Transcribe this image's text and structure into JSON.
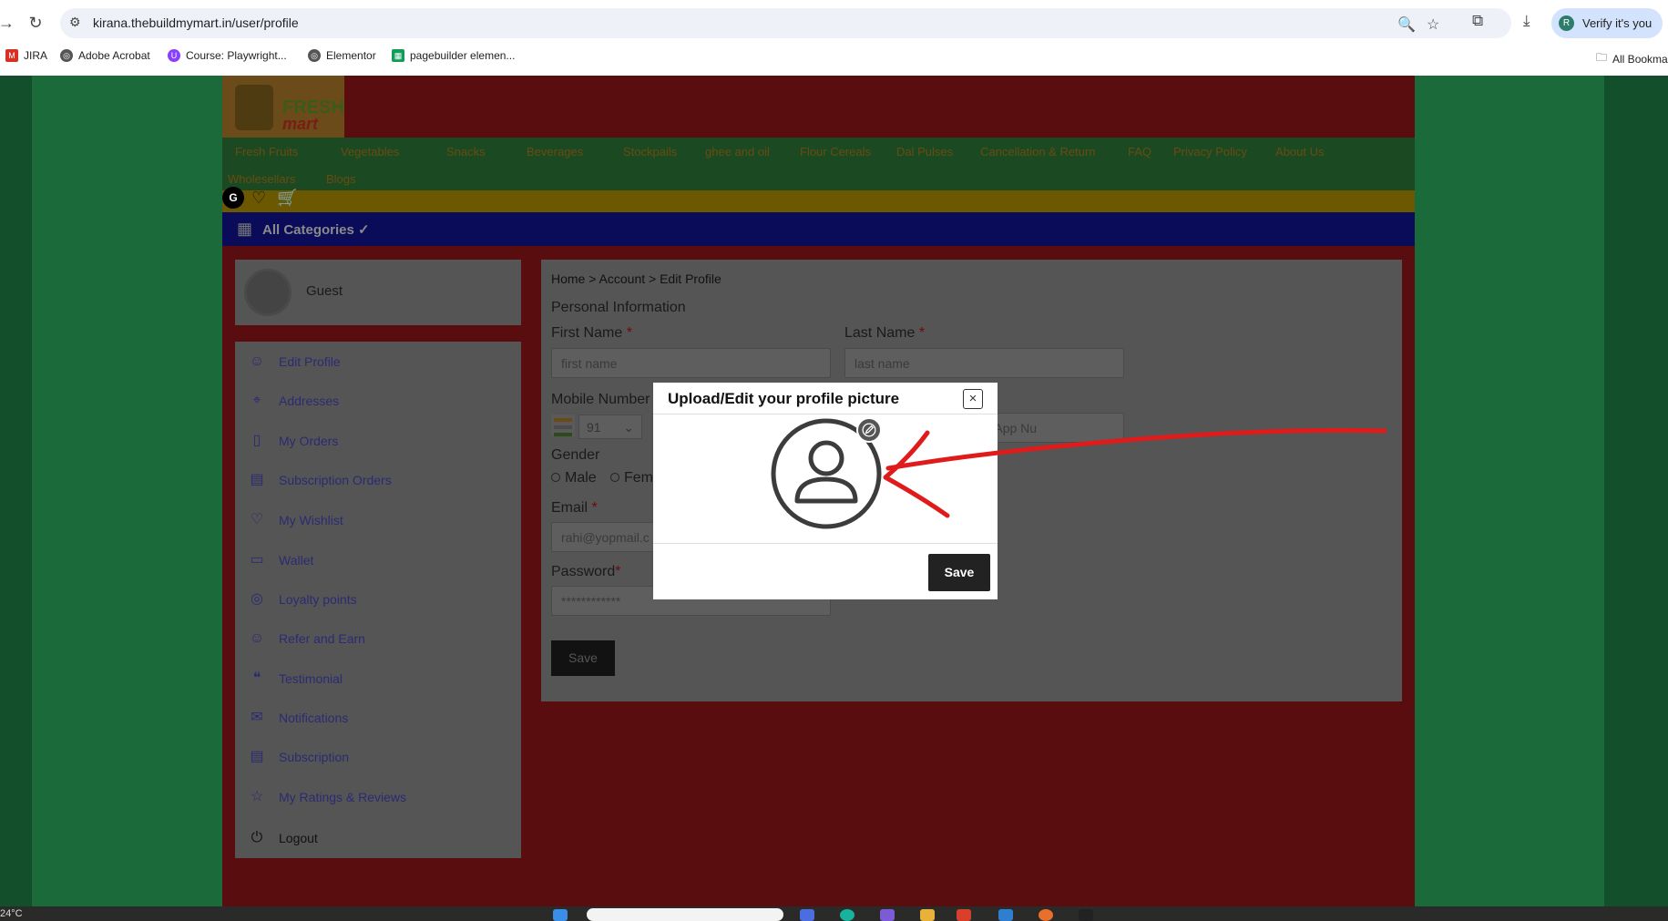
{
  "browser": {
    "url": "kirana.thebuildmymart.in/user/profile",
    "verify_label": "Verify it's you",
    "verify_avatar": "R",
    "bookmarks": [
      "JIRA",
      "Adobe Acrobat",
      "Course: Playwright...",
      "Elementor",
      "pagebuilder elemen..."
    ],
    "all_bookmarks": "All Bookma"
  },
  "site": {
    "logo_top": "FRESH",
    "logo_bottom": "mart",
    "nav": [
      "Fresh Fruits",
      "Vegetables",
      "Snacks",
      "Beverages",
      "Stockpails",
      "ghee and oil",
      "Flour Cereals",
      "Dal Pulses",
      "Cancellation & Return",
      "FAQ",
      "Privacy Policy",
      "About Us",
      "Wholesellars",
      "Blogs"
    ],
    "user_initial": "G",
    "all_categories": "All Categories ✓",
    "guest": "Guest",
    "menu": [
      "Edit Profile",
      "Addresses",
      "My Orders",
      "Subscription Orders",
      "My Wishlist",
      "Wallet",
      "Loyalty points",
      "Refer and Earn",
      "Testimonial",
      "Notifications",
      "Subscription",
      "My Ratings & Reviews",
      "Logout"
    ]
  },
  "form": {
    "breadcrumb": "Home > Account > Edit Profile",
    "section": "Personal Information",
    "first_name_label": "First Name",
    "last_name_label": "Last Name",
    "required_mark": "*",
    "first_name_placeholder": "first name",
    "last_name_placeholder": "last name",
    "mobile_label": "Mobile Number",
    "country_code": "91",
    "whatsapp_placeholder": "a WhatsApp Nu",
    "gender_label": "Gender",
    "gender_male": "Male",
    "gender_female": "Fem",
    "email_label": "Email",
    "email_value": "rahi@yopmail.c",
    "password_label": "Password",
    "password_value": "************",
    "save": "Save"
  },
  "modal": {
    "title": "Upload/Edit your profile picture",
    "close": "×",
    "save": "Save"
  },
  "taskbar": {
    "temperature": "24°C"
  },
  "colors": {
    "annotation_red": "#e01b1b",
    "modal_button": "#222222"
  }
}
